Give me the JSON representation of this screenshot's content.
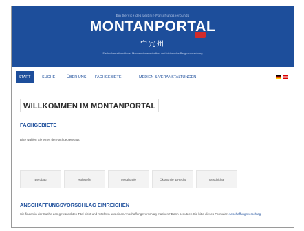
{
  "header": {
    "tagline": "Ein Service des Leibniz-Forschungsverbunds",
    "title": "MONTANPORTAL",
    "subtitle": "宀冗州",
    "foot": "Fachinformationsdienst Montanwissenschaften und historische Bergbauforschung",
    "badge_color": "#d22b2b",
    "brand_color": "#1d4e9b"
  },
  "nav": {
    "items": [
      "Start",
      "Suche",
      "Über uns",
      "Fachgebiete",
      "Medien & Veranstaltungen"
    ],
    "active_index": 0,
    "languages": [
      "de",
      "at"
    ]
  },
  "main": {
    "title": "WILLKOMMEN IM MONTANPORTAL",
    "fachgebiete": {
      "heading": "Fachgebiete",
      "intro": "Bitte wählen Sie eines der Fachgebiete aus:",
      "categories": [
        "Bergbau",
        "Rohstoffe",
        "Metallurgie",
        "Ökonomie & Recht",
        "Geschichte"
      ]
    },
    "anschaffung": {
      "heading": "Anschaffungsvorschlag einreichen",
      "text": "Sie finden in der Suche den gewünschten Titel nicht und möchten uns einen Anschaffungsvorschlag machen? Dann benutzen Sie bitte dieses Formular:",
      "link": "Anschaffungsvorschlag"
    }
  }
}
